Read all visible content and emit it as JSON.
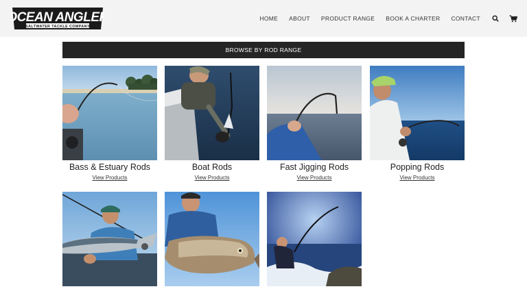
{
  "brand": {
    "name": "OCEAN ANGLER",
    "tagline": "SALTWATER TACKLE COMPANY"
  },
  "nav": {
    "items": [
      {
        "label": "HOME"
      },
      {
        "label": "ABOUT"
      },
      {
        "label": "PRODUCT RANGE"
      },
      {
        "label": "BOOK A CHARTER"
      },
      {
        "label": "CONTACT"
      }
    ],
    "icons": [
      "search-icon",
      "cart-icon"
    ]
  },
  "banner": {
    "label": "BROWSE BY ROD RANGE"
  },
  "categories": [
    {
      "title": "Bass & Estuary Rods",
      "link": "View Products"
    },
    {
      "title": "Boat Rods",
      "link": "View Products"
    },
    {
      "title": "Fast Jigging Rods",
      "link": "View Products"
    },
    {
      "title": "Popping Rods",
      "link": "View Products"
    },
    {
      "title": "",
      "link": ""
    },
    {
      "title": "",
      "link": ""
    },
    {
      "title": "",
      "link": ""
    }
  ],
  "colors": {
    "header_bg": "#f3f3f3",
    "banner_bg": "#252525",
    "banner_text": "#ffffff",
    "text": "#222222"
  }
}
